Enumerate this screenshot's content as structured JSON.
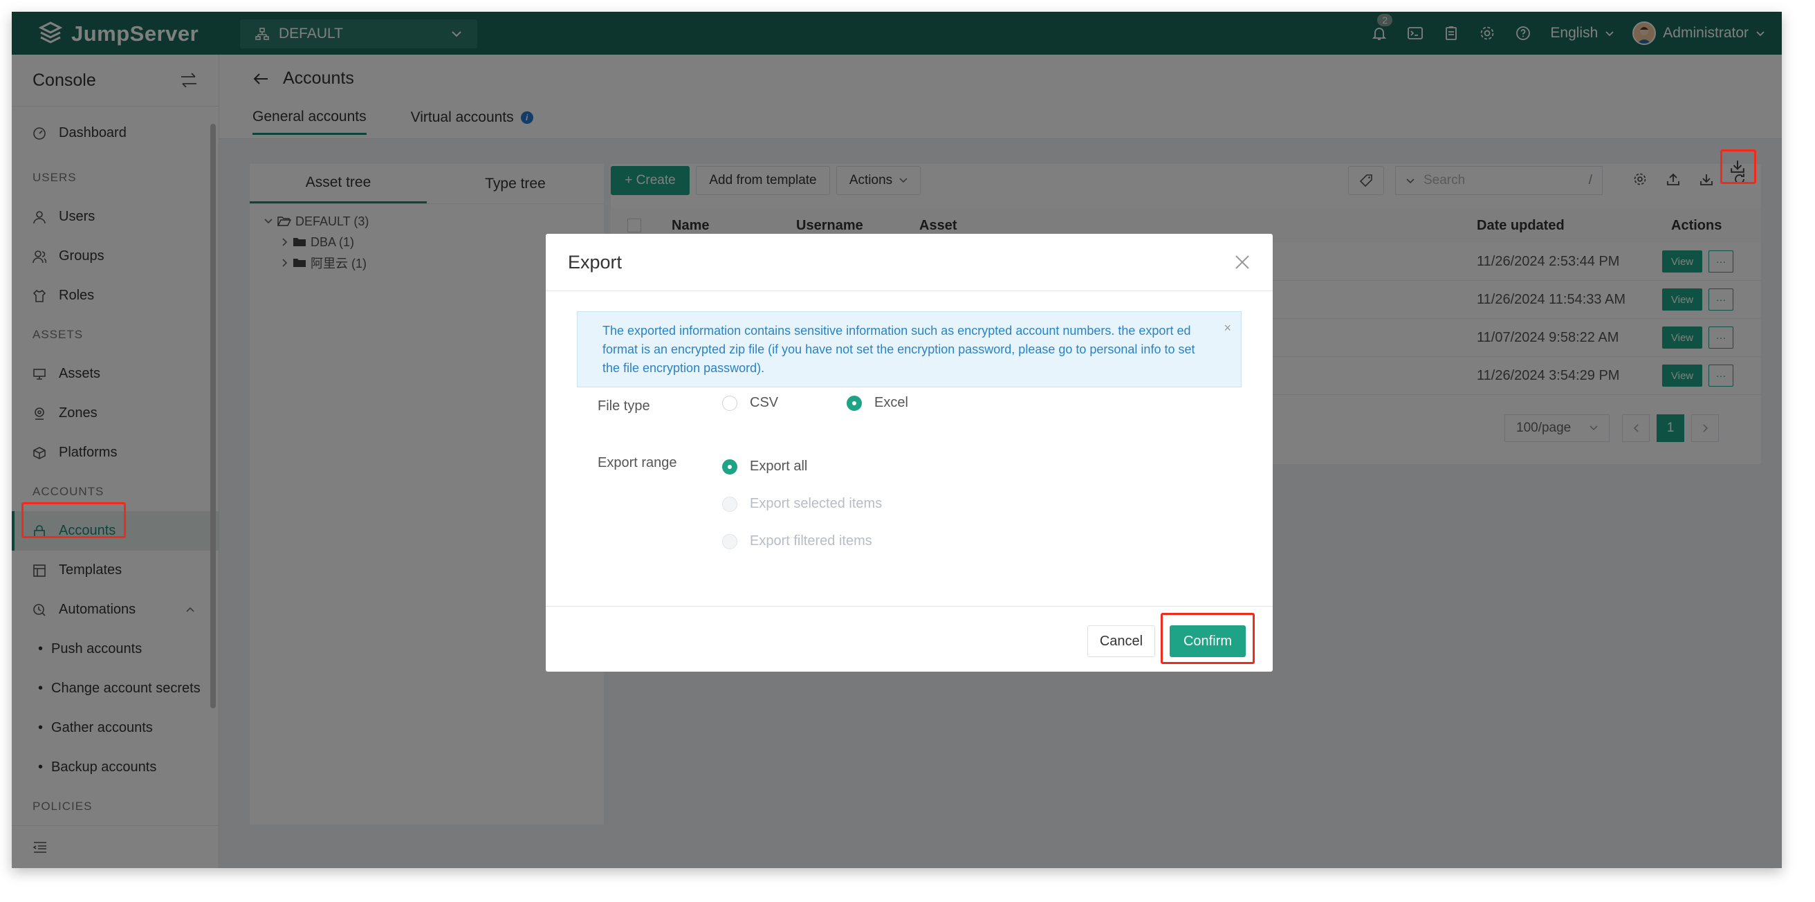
{
  "app": {
    "brand": "JumpServer",
    "org": "DEFAULT",
    "notification_count": "2",
    "language": "English",
    "user": "Administrator"
  },
  "sidebar": {
    "title": "Console",
    "dashboard": "Dashboard",
    "sections": {
      "users": "USERS",
      "assets": "ASSETS",
      "accounts": "ACCOUNTS",
      "policies": "POLICIES"
    },
    "items": {
      "users": "Users",
      "groups": "Groups",
      "roles": "Roles",
      "assets": "Assets",
      "zones": "Zones",
      "platforms": "Platforms",
      "accounts": "Accounts",
      "templates": "Templates",
      "automations": "Automations",
      "push": "Push accounts",
      "change_secrets": "Change account secrets",
      "gather": "Gather accounts",
      "backup": "Backup accounts"
    }
  },
  "page": {
    "title": "Accounts",
    "tabs": [
      "General accounts",
      "Virtual accounts"
    ]
  },
  "tree": {
    "tabs": [
      "Asset tree",
      "Type tree"
    ],
    "root": "DEFAULT (3)",
    "children": [
      "DBA (1)",
      "阿里云 (1)"
    ]
  },
  "toolbar": {
    "create": "+ Create",
    "add_from_template": "Add from template",
    "actions": "Actions",
    "search_placeholder": "Search",
    "search_shortcut": "/"
  },
  "table": {
    "columns": [
      "Name",
      "Username",
      "Asset",
      "Date updated",
      "Actions"
    ],
    "dates": [
      "11/26/2024 2:53:44 PM",
      "11/26/2024 11:54:33 AM",
      "11/07/2024 9:58:22 AM",
      "11/26/2024 3:54:29 PM"
    ],
    "view_label": "View",
    "more_label": "···"
  },
  "pagination": {
    "page_size": "100/page",
    "current_page": "1"
  },
  "modal": {
    "title": "Export",
    "alert": "The exported information contains sensitive information such as encrypted account numbers. the export ed format is an encrypted zip file (if you have not set the encryption password, please go to personal info to set the file encryption password).",
    "file_type_label": "File type",
    "file_type_options": [
      "CSV",
      "Excel"
    ],
    "file_type_selected": "Excel",
    "export_range_label": "Export range",
    "export_range_options": [
      "Export all",
      "Export selected items",
      "Export filtered items"
    ],
    "export_range_selected": "Export all",
    "cancel": "Cancel",
    "confirm": "Confirm"
  },
  "colors": {
    "topbar": "#1a6a5a",
    "primary": "#1fa386",
    "highlight": "#f02b1d",
    "alert_text": "#2a82c6"
  }
}
